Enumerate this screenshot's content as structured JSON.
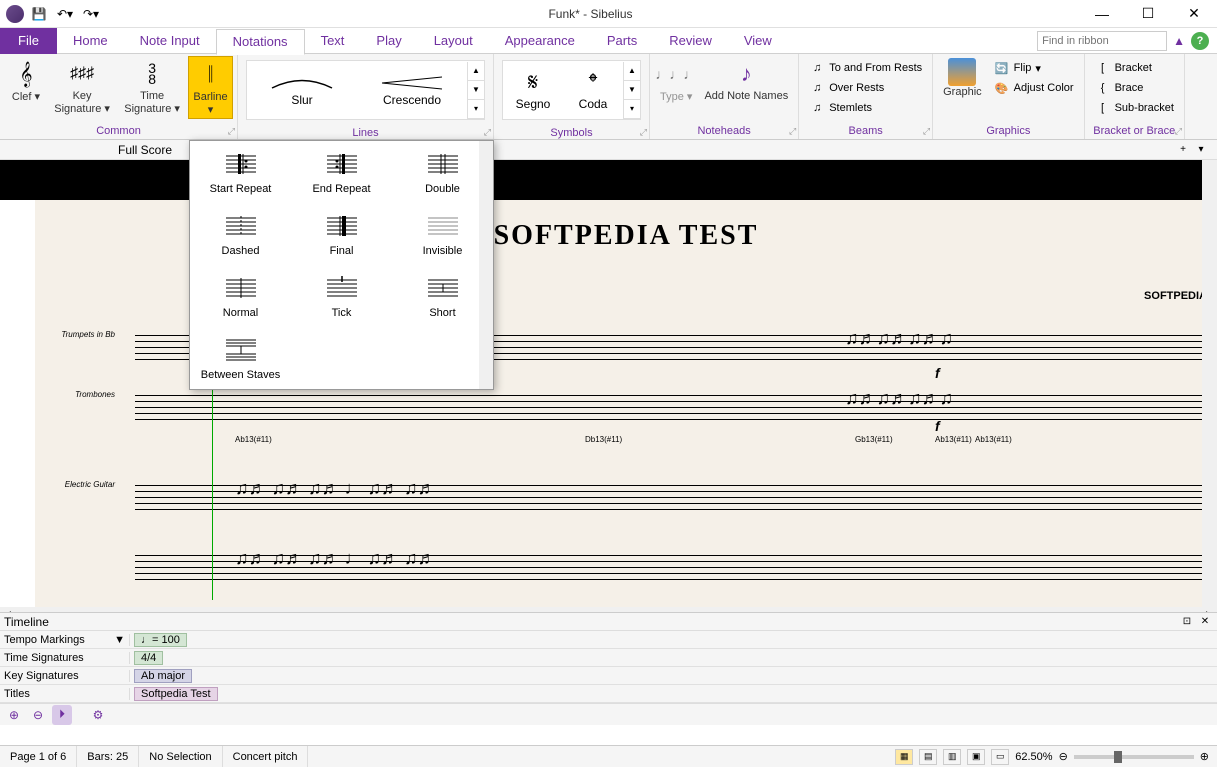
{
  "window": {
    "title": "Funk* - Sibelius"
  },
  "ribbon": {
    "file_label": "File",
    "tabs": [
      "Home",
      "Note Input",
      "Notations",
      "Text",
      "Play",
      "Layout",
      "Appearance",
      "Parts",
      "Review",
      "View"
    ],
    "active_tab": "Notations",
    "find_placeholder": "Find in ribbon"
  },
  "ribbon_groups": {
    "common": {
      "label": "Common",
      "buttons": [
        {
          "label": "Clef"
        },
        {
          "label": "Key Signature"
        },
        {
          "label": "Time Signature"
        },
        {
          "label": "Barline"
        }
      ]
    },
    "lines": {
      "label": "Lines",
      "items": [
        {
          "label": "Slur"
        },
        {
          "label": "Crescendo"
        }
      ]
    },
    "symbols": {
      "label": "Symbols",
      "items": [
        {
          "label": "Segno"
        },
        {
          "label": "Coda"
        }
      ]
    },
    "noteheads": {
      "label": "Noteheads",
      "buttons": [
        {
          "label": "Type"
        },
        {
          "label": "Add Note Names"
        }
      ]
    },
    "beams": {
      "label": "Beams",
      "items": [
        {
          "label": "To and From Rests"
        },
        {
          "label": "Over Rests"
        },
        {
          "label": "Stemlets"
        }
      ]
    },
    "graphics": {
      "label": "Graphics",
      "buttons": [
        {
          "label": "Graphic"
        }
      ],
      "items": [
        {
          "label": "Flip"
        },
        {
          "label": "Adjust Color"
        }
      ]
    },
    "bracket": {
      "label": "Bracket or Brace",
      "items": [
        {
          "label": "Bracket"
        },
        {
          "label": "Brace"
        },
        {
          "label": "Sub-bracket"
        }
      ]
    }
  },
  "sub_toolbar": {
    "label": "Full Score"
  },
  "barline_dropdown": {
    "items": [
      {
        "label": "Start Repeat"
      },
      {
        "label": "End Repeat"
      },
      {
        "label": "Double"
      },
      {
        "label": "Dashed"
      },
      {
        "label": "Final"
      },
      {
        "label": "Invisible"
      },
      {
        "label": "Normal"
      },
      {
        "label": "Tick"
      },
      {
        "label": "Short"
      },
      {
        "label": "Between Staves"
      }
    ]
  },
  "score": {
    "title": "SOFTPEDIA TEST",
    "composer": "SOFTPEDIA",
    "instruments": [
      "Trumpets in Bb",
      "Trombones",
      "Electric Guitar"
    ],
    "chords": [
      "Ab13(#11)",
      "Db13(#11)",
      "Gb13(#11)",
      "Ab13(#11)",
      "Ab13(#11)"
    ],
    "dynamics": "f"
  },
  "timeline": {
    "header": "Timeline",
    "rows": [
      {
        "label": "Tempo Markings",
        "value": "♩= 100"
      },
      {
        "label": "Time Signatures",
        "value": "4/4"
      },
      {
        "label": "Key Signatures",
        "value": "Ab major"
      },
      {
        "label": "Titles",
        "value": "Softpedia Test"
      }
    ]
  },
  "statusbar": {
    "page": "Page 1 of 6",
    "bars": "Bars: 25",
    "selection": "No Selection",
    "pitch": "Concert pitch",
    "zoom": "62.50%"
  }
}
